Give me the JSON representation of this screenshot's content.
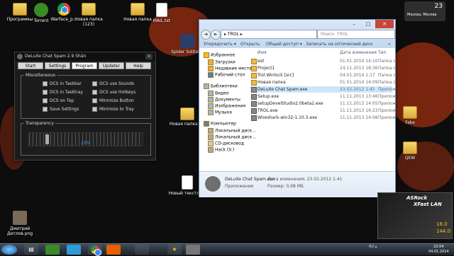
{
  "desktop": {
    "icons": [
      {
        "label": "Программы",
        "icon": "folder-icon"
      },
      {
        "label": "Torrent",
        "icon": "utorrent-icon"
      },
      {
        "label": "Warface_p...",
        "icon": "chrome-icon"
      },
      {
        "label": "Новая папка (123)",
        "icon": "folder-icon"
      },
      {
        "label": "Новая папка",
        "icon": "folder-icon"
      },
      {
        "label": "MAIL.txt",
        "icon": "text-file-icon"
      },
      {
        "label": "Spider Solitaire",
        "icon": "solitaire-icon"
      },
      {
        "label": "Новая папка (2)",
        "icon": "folder-icon"
      },
      {
        "label": "Новый текстов...",
        "icon": "text-file-icon"
      },
      {
        "label": "Дмитрий Детлов.png",
        "icon": "image-file-icon"
      },
      {
        "label": "Fake",
        "icon": "folder-icon"
      },
      {
        "label": "QEW",
        "icon": "folder-icon"
      }
    ]
  },
  "weather": {
    "temp": "23",
    "location": "Москва, Москва"
  },
  "dlx": {
    "title": "DeLuXe Chat Spam 2.9 Shän",
    "close": "x",
    "tabs": [
      "Start",
      "Settings",
      "Program",
      "Updater",
      "Help"
    ],
    "misc_legend": "Miscellaneous",
    "options": [
      "DCS in Taskbar",
      "DCS use Sounds",
      "DCS in Tasktray",
      "DCS use Hotkeys",
      "DCS on Top",
      "Minimize Button",
      "Save Settings",
      "Minimize to Tray"
    ],
    "transparency_legend": "Transparency",
    "transparency_value": "15%",
    "transparency_level": 0.15
  },
  "explorer": {
    "window_buttons": [
      "–",
      "□",
      "✕"
    ],
    "nav_back": "◄",
    "nav_forward": "►",
    "address": "▸ TROL ▸",
    "search_placeholder": "Поиск: TROL",
    "toolbar": [
      "Упорядочить ▾",
      "Открыть",
      "Общий доступ ▾",
      "Записать на оптический диск",
      "»"
    ],
    "sidebar": {
      "favorites_header": "Избранное",
      "favorites": [
        "Загрузки",
        "Недавние места",
        "Рабочий стол"
      ],
      "libraries_header": "Библиотеки",
      "libraries": [
        "Видео",
        "Документы",
        "Изображения",
        "Музыка"
      ],
      "computer_header": "Компьютер",
      "drives": [
        "Локальный диск...",
        "Локальный диск...",
        "CD-дисковод",
        "Hack (S:)"
      ]
    },
    "columns": {
      "name": "Имя",
      "date": "Дата изменения",
      "type": "Тип"
    },
    "files": [
      {
        "name": "ext",
        "date": "01.01.2014 14:10",
        "type": "Папка с",
        "kind": "folder"
      },
      {
        "name": "Project1",
        "date": "24.11.2013 18:36",
        "type": "Папка с",
        "kind": "folder"
      },
      {
        "name": "Trol.Winlock [src]",
        "date": "04.01.2014 1:17",
        "type": "Папка с",
        "kind": "folder"
      },
      {
        "name": "Новая папка",
        "date": "01.01.2014 14:09",
        "type": "Папка с",
        "kind": "folder"
      },
      {
        "name": "DeLuXe Chat Spam.exe",
        "date": "23.02.2012 1:41",
        "type": "Прилож",
        "kind": "exe"
      },
      {
        "name": "Setup.exe",
        "date": "11.11.2013 13:46",
        "type": "Прилож",
        "kind": "exe"
      },
      {
        "name": "setupDevelStudio2.0beta2.exe",
        "date": "11.11.2013 14:05",
        "type": "Прилож",
        "kind": "exe"
      },
      {
        "name": "TROL.exe",
        "date": "11.11.2013 16:22",
        "type": "Прилож",
        "kind": "exe"
      },
      {
        "name": "Wireshark-win32-1.10.3.exe",
        "date": "11.11.2013 14:08",
        "type": "Прилож",
        "kind": "exe"
      }
    ],
    "selected_index": 4,
    "status": {
      "name": "DeLuXe Chat Spam.exe",
      "date_label": "Дата изменения: 23.02.2012 1:41",
      "type": "Приложение",
      "size_label": "Размер: 0,98 МБ"
    }
  },
  "asrock": {
    "brand": "ASRock",
    "product": "XFast LAN",
    "value1": "18.0",
    "value2": "144.0"
  },
  "taskbar": {
    "items": [
      "folder",
      "utorrent",
      "skype",
      "chrome",
      "firefox",
      "app",
      "star",
      "deluxe"
    ],
    "tray": "RU ▴",
    "time": "22:04",
    "date": "04.01.2014"
  }
}
